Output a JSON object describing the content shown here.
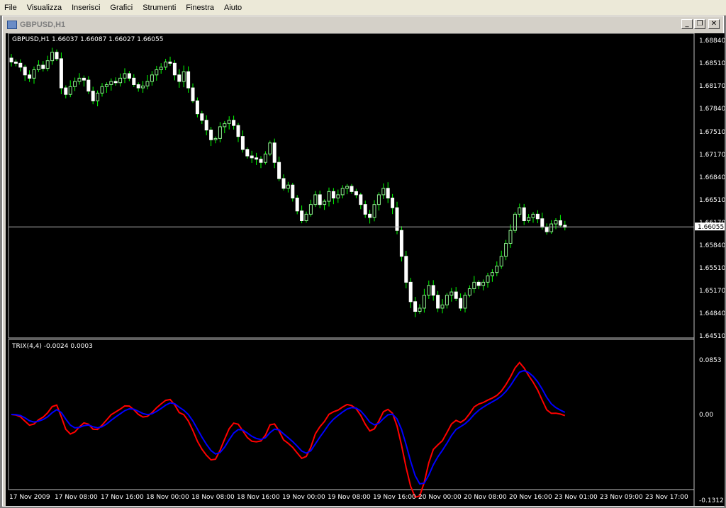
{
  "menu": [
    "File",
    "Visualizza",
    "Inserisci",
    "Grafici",
    "Strumenti",
    "Finestra",
    "Aiuto"
  ],
  "window": {
    "title": "GBPUSD,H1",
    "minimize_glyph": "_",
    "restore_glyph": "❐",
    "close_glyph": "✕"
  },
  "price_panel": {
    "header": "GBPUSD,H1  1.66037 1.66087 1.66027 1.66055",
    "price_labels": [
      "1.68840",
      "1.68510",
      "1.68170",
      "1.67840",
      "1.67510",
      "1.67170",
      "1.66840",
      "1.66510",
      "1.66170",
      "1.65840",
      "1.65510",
      "1.65170",
      "1.64840",
      "1.64510"
    ],
    "current_price_label": "1.66055",
    "current_price": 1.66055,
    "colors": {
      "bull": "#90ee90",
      "bear": "#ffffff",
      "wick": "#00ff00"
    }
  },
  "indicator_panel": {
    "header": "TRIX(4,4) -0.0024 0.0003",
    "scale_labels": [
      "0.0853",
      "0.00",
      "-0.1312"
    ],
    "colors": {
      "trix": "#ff0000",
      "signal": "#0000ff"
    }
  },
  "time_axis": [
    "17 Nov 2009",
    "17 Nov 08:00",
    "17 Nov 16:00",
    "18 Nov 00:00",
    "18 Nov 08:00",
    "18 Nov 16:00",
    "19 Nov 00:00",
    "19 Nov 08:00",
    "19 Nov 16:00",
    "20 Nov 00:00",
    "20 Nov 08:00",
    "20 Nov 16:00",
    "23 Nov 01:00",
    "23 Nov 09:00",
    "23 Nov 17:00"
  ],
  "chart_data": {
    "type": "candlestick",
    "title": "GBPUSD,H1",
    "ylim": [
      1.6434,
      1.6901
    ],
    "closes": [
      1.686,
      1.6858,
      1.6852,
      1.684,
      1.6835,
      1.6848,
      1.6855,
      1.685,
      1.6862,
      1.6875,
      1.6865,
      1.682,
      1.681,
      1.6822,
      1.683,
      1.6835,
      1.6832,
      1.6815,
      1.68,
      1.6812,
      1.6822,
      1.6825,
      1.683,
      1.6828,
      1.6835,
      1.6842,
      1.6835,
      1.6825,
      1.682,
      1.6823,
      1.683,
      1.684,
      1.6848,
      1.6852,
      1.686,
      1.6858,
      1.684,
      1.683,
      1.6845,
      1.682,
      1.68,
      1.678,
      1.677,
      1.6755,
      1.674,
      1.6742,
      1.676,
      1.6765,
      1.677,
      1.6762,
      1.6745,
      1.6725,
      1.6715,
      1.6712,
      1.671,
      1.6705,
      1.6718,
      1.6735,
      1.6705,
      1.668,
      1.6665,
      1.667,
      1.665,
      1.663,
      1.6615,
      1.6625,
      1.664,
      1.6655,
      1.664,
      1.6645,
      1.666,
      1.665,
      1.6655,
      1.6665,
      1.6668,
      1.666,
      1.6655,
      1.664,
      1.6625,
      1.662,
      1.664,
      1.6655,
      1.6665,
      1.665,
      1.6635,
      1.66,
      1.656,
      1.652,
      1.649,
      1.6475,
      1.648,
      1.65,
      1.6515,
      1.65,
      1.648,
      1.6485,
      1.65,
      1.6505,
      1.6495,
      1.648,
      1.65,
      1.651,
      1.652,
      1.6515,
      1.652,
      1.653,
      1.6535,
      1.6545,
      1.656,
      1.658,
      1.66,
      1.6625,
      1.6635,
      1.6615,
      1.662,
      1.6625,
      1.6618,
      1.6605,
      1.6598,
      1.661,
      1.6615,
      1.6608,
      1.6605
    ]
  }
}
